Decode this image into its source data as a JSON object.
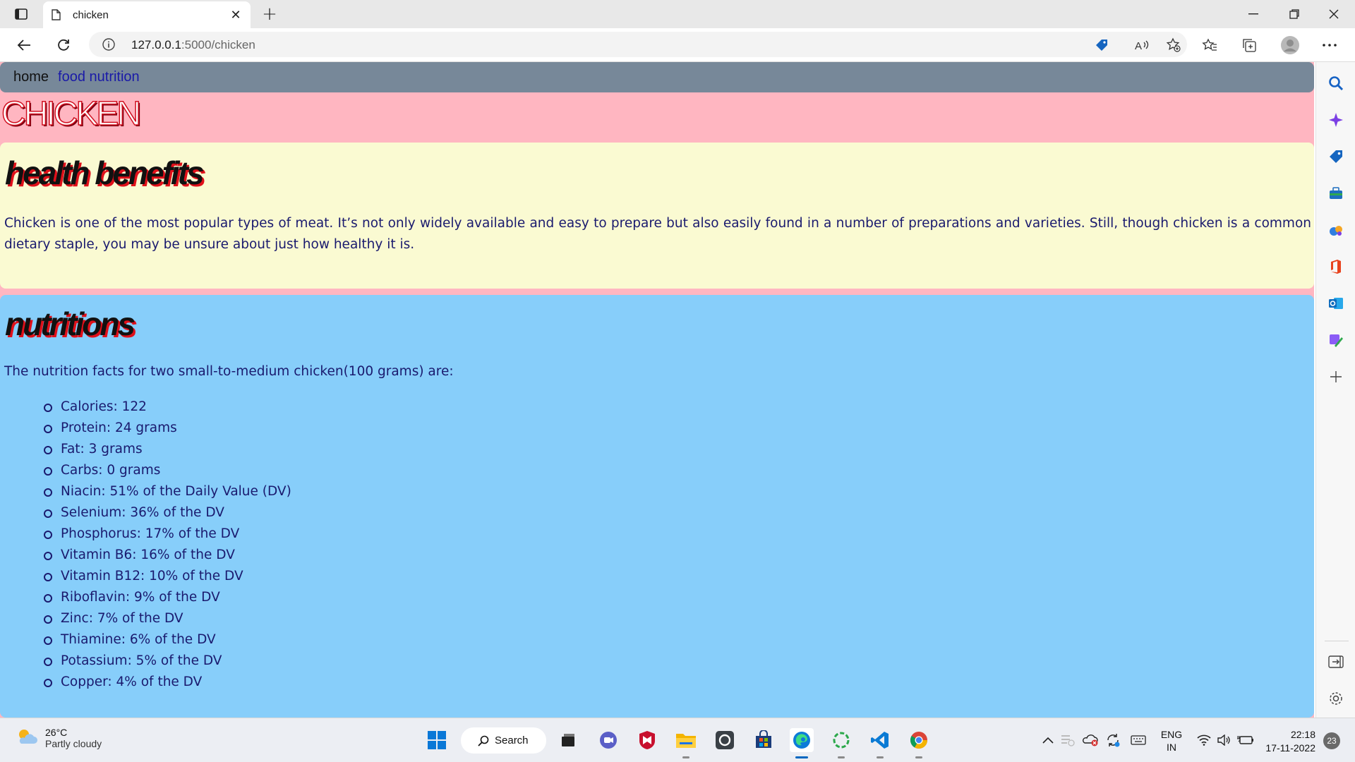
{
  "browser": {
    "tab_title": "chicken",
    "url_host": "127.0.0.1",
    "url_path": ":5000/chicken"
  },
  "page": {
    "nav": {
      "home": "home",
      "food_nutrition": "food nutrition"
    },
    "heading": "CHICKEN",
    "health": {
      "title": "health benefits",
      "text": "Chicken is one of the most popular types of meat. It’s not only widely available and easy to prepare but also easily found in a number of preparations and varieties. Still, though chicken is a common dietary staple, you may be unsure about just how healthy it is."
    },
    "nutrition": {
      "title": "nutritions",
      "intro": "The nutrition facts for two small-to-medium chicken(100 grams) are:",
      "items": [
        "Calories: 122",
        "Protein: 24 grams",
        "Fat: 3 grams",
        "Carbs: 0 grams",
        "Niacin: 51% of the Daily Value (DV)",
        "Selenium: 36% of the DV",
        "Phosphorus: 17% of the DV",
        "Vitamin B6: 16% of the DV",
        "Vitamin B12: 10% of the DV",
        "Riboflavin: 9% of the DV",
        "Zinc: 7% of the DV",
        "Thiamine: 6% of the DV",
        "Potassium: 5% of the DV",
        "Copper: 4% of the DV"
      ]
    },
    "colors": {
      "body_bg": "#ffb6c1",
      "nav_bg": "#778899",
      "health_bg": "#fafad2",
      "nutrition_bg": "#87cefa",
      "heading_shadow": "#e0101a"
    }
  },
  "taskbar": {
    "weather_temp": "26°C",
    "weather_condition": "Partly cloudy",
    "search_label": "Search",
    "lang_top": "ENG",
    "lang_bottom": "IN",
    "time": "22:18",
    "date": "17-11-2022",
    "notification_count": "23"
  }
}
